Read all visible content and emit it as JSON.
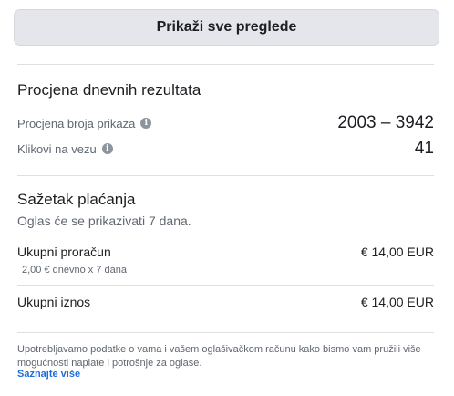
{
  "header": {
    "show_all_label": "Prikaži sve preglede"
  },
  "estimate": {
    "title": "Procjena dnevnih rezultata",
    "rows": [
      {
        "label": "Procjena broja prikaza",
        "value": "2003 – 3942",
        "icon": "info-icon"
      },
      {
        "label": "Klikovi na vezu",
        "value": "41",
        "icon": "info-icon"
      }
    ]
  },
  "payment": {
    "title": "Sažetak plaćanja",
    "subtitle": "Oglas će se prikazivati 7 dana.",
    "budget_label": "Ukupni proračun",
    "budget_value": "€ 14,00 EUR",
    "budget_detail": "2,00 € dnevno x 7 dana",
    "total_label": "Ukupni iznos",
    "total_value": "€ 14,00 EUR"
  },
  "footer": {
    "text": "Upotrebljavamo podatke o vama i vašem oglašivačkom računu kako bismo vam pružili više mogućnosti naplate i potrošnje za oglase.",
    "link": "Saznajte više"
  }
}
